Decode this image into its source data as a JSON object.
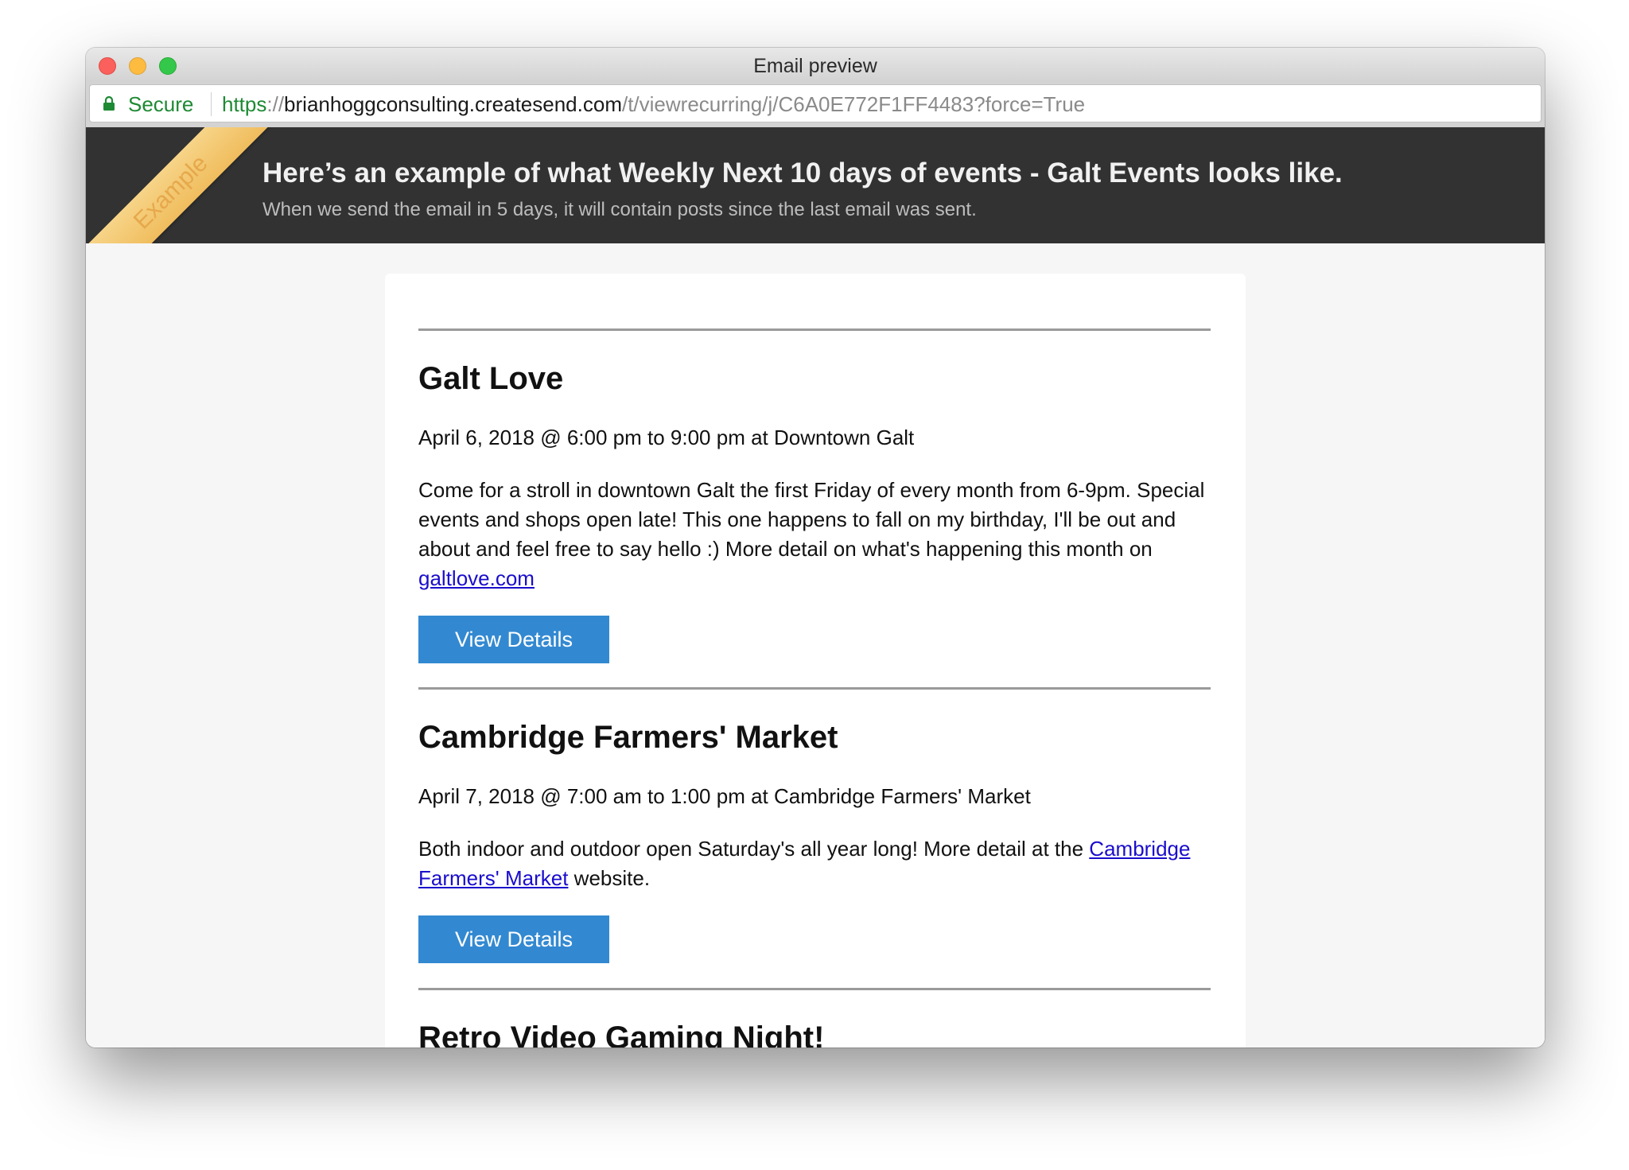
{
  "window": {
    "title": "Email preview"
  },
  "address_bar": {
    "secure_label": "Secure",
    "url_scheme": "https",
    "url_separator": "://",
    "url_host": "brianhoggconsulting.createsend.com",
    "url_path": "/t/viewrecurring/j/C6A0E772F1FF4483?force=True",
    "secure_color": "#1e8a34"
  },
  "banner": {
    "ribbon_label": "Example",
    "title": "Here’s an example of what Weekly Next 10 days of events - Galt Events looks like.",
    "subtitle": "When we send the email in 5 days, it will contain posts since the last email was sent.",
    "background": "#323232",
    "ribbon_color": "#f0bd5d"
  },
  "events": [
    {
      "title": "Galt Love",
      "when": "April 6, 2018 @ 6:00 pm to 9:00 pm at Downtown Galt",
      "description_before": "Come for a stroll in downtown Galt the first Friday of every month from 6-9pm.  Special events and shops open late! This one happens to fall on my birthday, I'll be out and about and feel free to say hello :) More detail on what's happening this month on ",
      "link_text": "galtlove.com",
      "description_after": "",
      "button_label": "View Details"
    },
    {
      "title": "Cambridge Farmers' Market",
      "when": "April 7, 2018 @ 7:00 am to 1:00 pm at Cambridge Farmers' Market",
      "description_before": "Both indoor and outdoor open Saturday's all year long! More detail at the ",
      "link_text": "Cambridge Farmers' Market",
      "description_after": " website.",
      "button_label": "View Details"
    },
    {
      "title": "Retro Video Gaming Night!"
    }
  ],
  "colors": {
    "button": "#3389d1",
    "link": "#1a0dcc"
  }
}
